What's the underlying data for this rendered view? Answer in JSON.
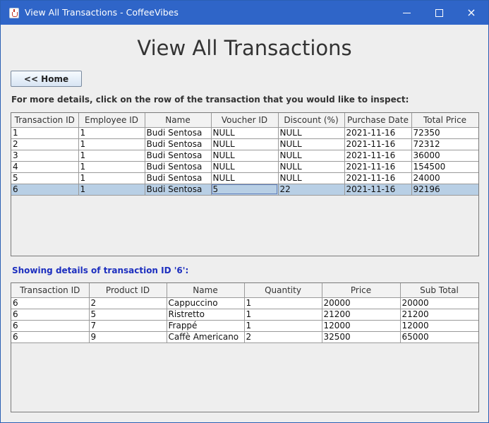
{
  "window": {
    "title": "View All Transactions - CoffeeVibes",
    "controls": {
      "minimize": "minimize",
      "maximize": "maximize",
      "close": "×"
    }
  },
  "heading": "View All Transactions",
  "home_button": "<< Home",
  "instruction": "For more details, click on the row of the transaction that you would like to inspect:",
  "transactions": {
    "columns": [
      "Transaction ID",
      "Employee ID",
      "Name",
      "Voucher ID",
      "Discount (%)",
      "Purchase Date",
      "Total Price"
    ],
    "rows": [
      [
        "1",
        "1",
        "Budi Sentosa",
        "NULL",
        "NULL",
        "2021-11-16",
        "72350"
      ],
      [
        "2",
        "1",
        "Budi Sentosa",
        "NULL",
        "NULL",
        "2021-11-16",
        "72312"
      ],
      [
        "3",
        "1",
        "Budi Sentosa",
        "NULL",
        "NULL",
        "2021-11-16",
        "36000"
      ],
      [
        "4",
        "1",
        "Budi Sentosa",
        "NULL",
        "NULL",
        "2021-11-16",
        "154500"
      ],
      [
        "5",
        "1",
        "Budi Sentosa",
        "NULL",
        "NULL",
        "2021-11-16",
        "24000"
      ],
      [
        "6",
        "1",
        "Budi Sentosa",
        "5",
        "22",
        "2021-11-16",
        "92196"
      ]
    ],
    "selected_row": 5
  },
  "detail_caption": "Showing details of transaction ID '6':",
  "details": {
    "columns": [
      "Transaction ID",
      "Product ID",
      "Name",
      "Quantity",
      "Price",
      "Sub Total"
    ],
    "rows": [
      [
        "6",
        "2",
        "Cappuccino",
        "1",
        "20000",
        "20000"
      ],
      [
        "6",
        "5",
        "Ristretto",
        "1",
        "21200",
        "21200"
      ],
      [
        "6",
        "7",
        "Frappé",
        "1",
        "12000",
        "12000"
      ],
      [
        "6",
        "9",
        "Caffè Americano",
        "2",
        "32500",
        "65000"
      ]
    ]
  },
  "colors": {
    "titlebar": "#2f65c8",
    "selection": "#b8cfe5",
    "caption": "#1d2fbf"
  }
}
